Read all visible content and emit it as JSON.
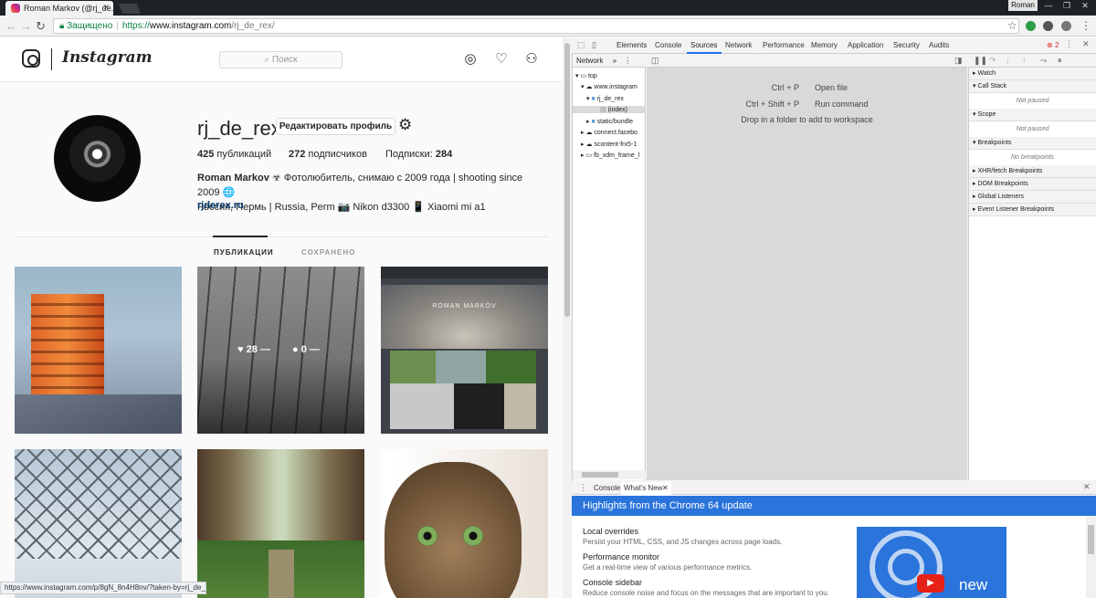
{
  "browser": {
    "tab_title": "Roman Markov (@rj_de...",
    "user": "Roman",
    "secure_label": "Защищено",
    "url_scheme": "https://",
    "url_domain": "www.instagram.com",
    "url_path": "/rj_de_rex/",
    "status_url": "https://www.instagram.com/p/8gN_8n4H8nv/?taken-by=rj_de_rex"
  },
  "instagram": {
    "logo_text": "Instagram",
    "search_placeholder": "Поиск",
    "username": "rj_de_rex",
    "edit_profile": "Редактировать профиль",
    "stats": {
      "posts_count": "425",
      "posts_label": "публикаций",
      "followers_count": "272",
      "followers_label": "подписчиков",
      "following_label": "Подписки:",
      "following_count": "284"
    },
    "bio_name": "Roman Markov",
    "bio_line1": "☣ Фотолюбитель, снимаю с 2009 года | shooting since 2009 🌐",
    "bio_line2": "Россия, Пермь | Russia, Perm 📷 Nikon d3300 📱 Xiaomi mi a1",
    "bio_link": "rjderex.ru",
    "tabs": [
      "ПУБЛИКАЦИИ",
      "СОХРАНЕНО"
    ],
    "hover_likes": "28",
    "hover_comments": "0",
    "post3_title": "ROMAN MARKOV"
  },
  "devtools": {
    "tabs": [
      "Elements",
      "Console",
      "Sources",
      "Network",
      "Performance",
      "Memory",
      "Application",
      "Security",
      "Audits"
    ],
    "active_tab": "Sources",
    "error_count": "2",
    "navigator_tab": "Network",
    "tree": [
      "top",
      "www.instagram",
      "rj_de_rex",
      "(index)",
      "static/bundle",
      "connect.facebo",
      "scontent-frx5-1",
      "fb_xdm_frame_l"
    ],
    "shortcuts": [
      {
        "key": "Ctrl + P",
        "label": "Open file"
      },
      {
        "key": "Ctrl + Shift + P",
        "label": "Run command"
      }
    ],
    "drop_hint": "Drop in a folder to add to workspace",
    "sections": {
      "watch": "Watch",
      "call_stack": "Call Stack",
      "not_paused_1": "Not paused",
      "scope": "Scope",
      "not_paused_2": "Not paused",
      "breakpoints": "Breakpoints",
      "no_breakpoints": "No breakpoints",
      "xhr": "XHR/fetch Breakpoints",
      "dom": "DOM Breakpoints",
      "global": "Global Listeners",
      "event": "Event Listener Breakpoints"
    },
    "drawer_tabs": [
      "Console",
      "What's New"
    ],
    "banner": "Highlights from the Chrome 64 update",
    "whatsnew": [
      {
        "title": "Local overrides",
        "desc": "Persist your HTML, CSS, and JS changes across page loads."
      },
      {
        "title": "Performance monitor",
        "desc": "Get a real-time view of various performance metrics."
      },
      {
        "title": "Console sidebar",
        "desc": "Reduce console noise and focus on the messages that are important to you."
      }
    ],
    "video_label": "new"
  }
}
